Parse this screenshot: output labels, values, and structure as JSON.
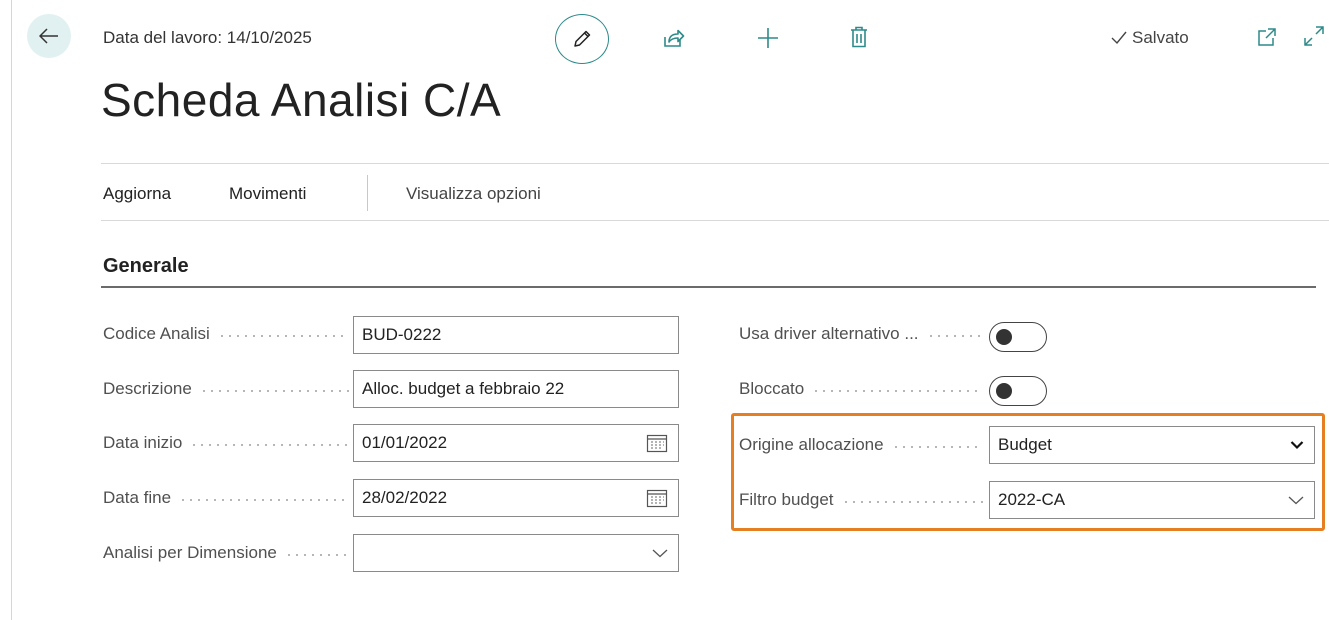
{
  "header": {
    "work_date": "Data del lavoro: 14/10/2025",
    "saved_label": "Salvato"
  },
  "page": {
    "title": "Scheda Analisi C/A"
  },
  "actions": {
    "refresh": "Aggiorna",
    "entries": "Movimenti",
    "view_options": "Visualizza opzioni"
  },
  "section": {
    "title": "Generale"
  },
  "fields_left": {
    "code": {
      "label": "Codice Analisi",
      "value": "BUD-0222"
    },
    "description": {
      "label": "Descrizione",
      "value": "Alloc. budget a febbraio 22"
    },
    "start_date": {
      "label": "Data inizio",
      "value": "01/01/2022"
    },
    "end_date": {
      "label": "Data fine",
      "value": "28/02/2022"
    },
    "analysis_by_dimension": {
      "label": "Analisi per Dimensione",
      "value": ""
    }
  },
  "fields_right": {
    "alt_driver": {
      "label": "Usa driver alternativo ...",
      "checked": false
    },
    "blocked": {
      "label": "Bloccato",
      "checked": false
    },
    "allocation_source": {
      "label": "Origine allocazione",
      "value": "Budget"
    },
    "budget_filter": {
      "label": "Filtro budget",
      "value": "2022-CA"
    }
  },
  "colors": {
    "accent": "#2e8a8a",
    "highlight": "#e67e22"
  },
  "icons": [
    "back-arrow-icon",
    "pencil-icon",
    "share-icon",
    "plus-icon",
    "trash-icon",
    "checkmark-icon",
    "open-new-window-icon",
    "expand-icon",
    "calendar-icon",
    "chevron-down-icon"
  ]
}
